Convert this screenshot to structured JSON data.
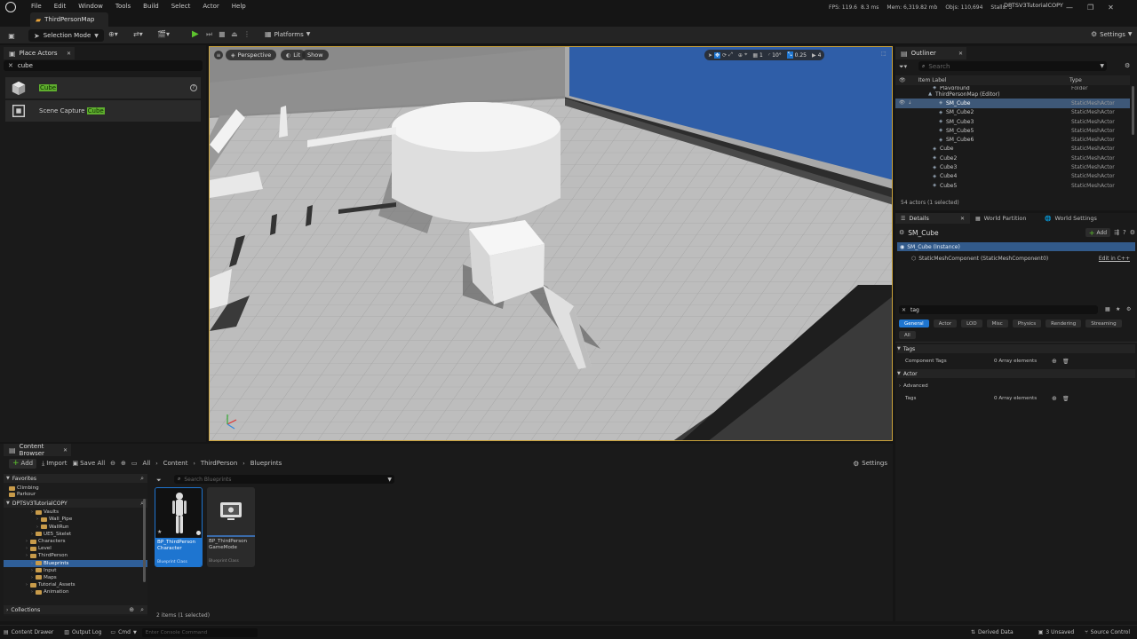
{
  "menu": [
    "File",
    "Edit",
    "Window",
    "Tools",
    "Build",
    "Select",
    "Actor",
    "Help"
  ],
  "map_tab": "ThirdPersonMap",
  "stats": {
    "fps": "FPS: 119.6",
    "ms": "8.3 ms",
    "mem": "Mem: 6,319.82 mb",
    "objs": "Objs: 110,694",
    "stalls": "Stalls: 3"
  },
  "project_name": "DPTSV3TutorialCOPY",
  "toolbar": {
    "mode": "Selection Mode",
    "platforms": "Platforms",
    "settings": "Settings"
  },
  "place_actors": {
    "tab": "Place Actors",
    "search_value": "cube",
    "items": [
      {
        "name": "Cube"
      },
      {
        "name": "Scene Capture Cube",
        "pre": "Scene Capture ",
        "match": "Cube"
      }
    ]
  },
  "viewport": {
    "perspective": "Perspective",
    "lit": "Lit",
    "show": "Show",
    "fov": "10°",
    "speed": "0.25",
    "cam": "4",
    "grid": "1"
  },
  "outliner": {
    "tab": "Outliner",
    "search_placeholder": "Search",
    "col_label": "Item Label",
    "col_type": "Type",
    "rows": [
      {
        "label": "Playground",
        "type": "Folder",
        "indent": 50
      },
      {
        "label": "ThirdPersonMap (Editor)",
        "type": "",
        "indent": 45
      },
      {
        "label": "SM_Cube",
        "type": "StaticMeshActor",
        "indent": 57,
        "selected": true
      },
      {
        "label": "SM_Cube2",
        "type": "StaticMeshActor",
        "indent": 57
      },
      {
        "label": "SM_Cube3",
        "type": "StaticMeshActor",
        "indent": 57
      },
      {
        "label": "SM_Cube5",
        "type": "StaticMeshActor",
        "indent": 57
      },
      {
        "label": "SM_Cube6",
        "type": "StaticMeshActor",
        "indent": 57
      },
      {
        "label": "Cube",
        "type": "StaticMeshActor",
        "indent": 50
      },
      {
        "label": "Cube2",
        "type": "StaticMeshActor",
        "indent": 50
      },
      {
        "label": "Cube3",
        "type": "StaticMeshActor",
        "indent": 50
      },
      {
        "label": "Cube4",
        "type": "StaticMeshActor",
        "indent": 50
      },
      {
        "label": "Cube5",
        "type": "StaticMeshActor",
        "indent": 50
      }
    ],
    "footer": "54 actors (1 selected)"
  },
  "details": {
    "tabs": [
      "Details",
      "World Partition",
      "World Settings"
    ],
    "actor": "SM_Cube",
    "add": "Add",
    "instance": "SM_Cube (Instance)",
    "component": "StaticMeshComponent (StaticMeshComponent0)",
    "edit_cpp": "Edit in C++",
    "search_value": "tag",
    "filters": [
      "General",
      "Actor",
      "LOD",
      "Misc",
      "Physics",
      "Rendering",
      "Streaming"
    ],
    "filter_all": "All",
    "sec_tags": "Tags",
    "component_tags": "Component Tags",
    "array_val": "0 Array elements",
    "sec_actor": "Actor",
    "advanced": "Advanced",
    "tags": "Tags"
  },
  "content_browser": {
    "tab": "Content Browser",
    "add": "Add",
    "import": "Import",
    "save_all": "Save All",
    "path": [
      "All",
      "Content",
      "ThirdPerson",
      "Blueprints"
    ],
    "settings": "Settings",
    "favorites": "Favorites",
    "fav_items": [
      "Climbing",
      "Parkour"
    ],
    "project": "DPTSV3TutorialCOPY",
    "tree": [
      {
        "label": "Vaults",
        "indent": 34
      },
      {
        "label": "Wall_Pipe",
        "indent": 40
      },
      {
        "label": "WallRun",
        "indent": 40
      },
      {
        "label": "UE5_Skelet",
        "indent": 34
      },
      {
        "label": "Characters",
        "indent": 28
      },
      {
        "label": "Level",
        "indent": 28
      },
      {
        "label": "ThirdPerson",
        "indent": 28
      },
      {
        "label": "Blueprints",
        "indent": 34,
        "selected": true
      },
      {
        "label": "Input",
        "indent": 34
      },
      {
        "label": "Maps",
        "indent": 34
      },
      {
        "label": "Tutorial_Assets",
        "indent": 28
      },
      {
        "label": "Animation",
        "indent": 34
      }
    ],
    "collections": "Collections",
    "search_placeholder": "Search Blueprints",
    "assets": [
      {
        "line1": "BP_ThirdPerson",
        "line2": "Character",
        "kind": "Blueprint Class"
      },
      {
        "line1": "BP_ThirdPerson",
        "line2": "GameMode",
        "kind": "Blueprint Class"
      }
    ],
    "count": "2 items (1 selected)"
  },
  "statusbar": {
    "drawer": "Content Drawer",
    "output": "Output Log",
    "cmd": "Cmd",
    "console_placeholder": "Enter Console Command",
    "derived": "Derived Data",
    "unsaved": "3 Unsaved",
    "source": "Source Control"
  }
}
